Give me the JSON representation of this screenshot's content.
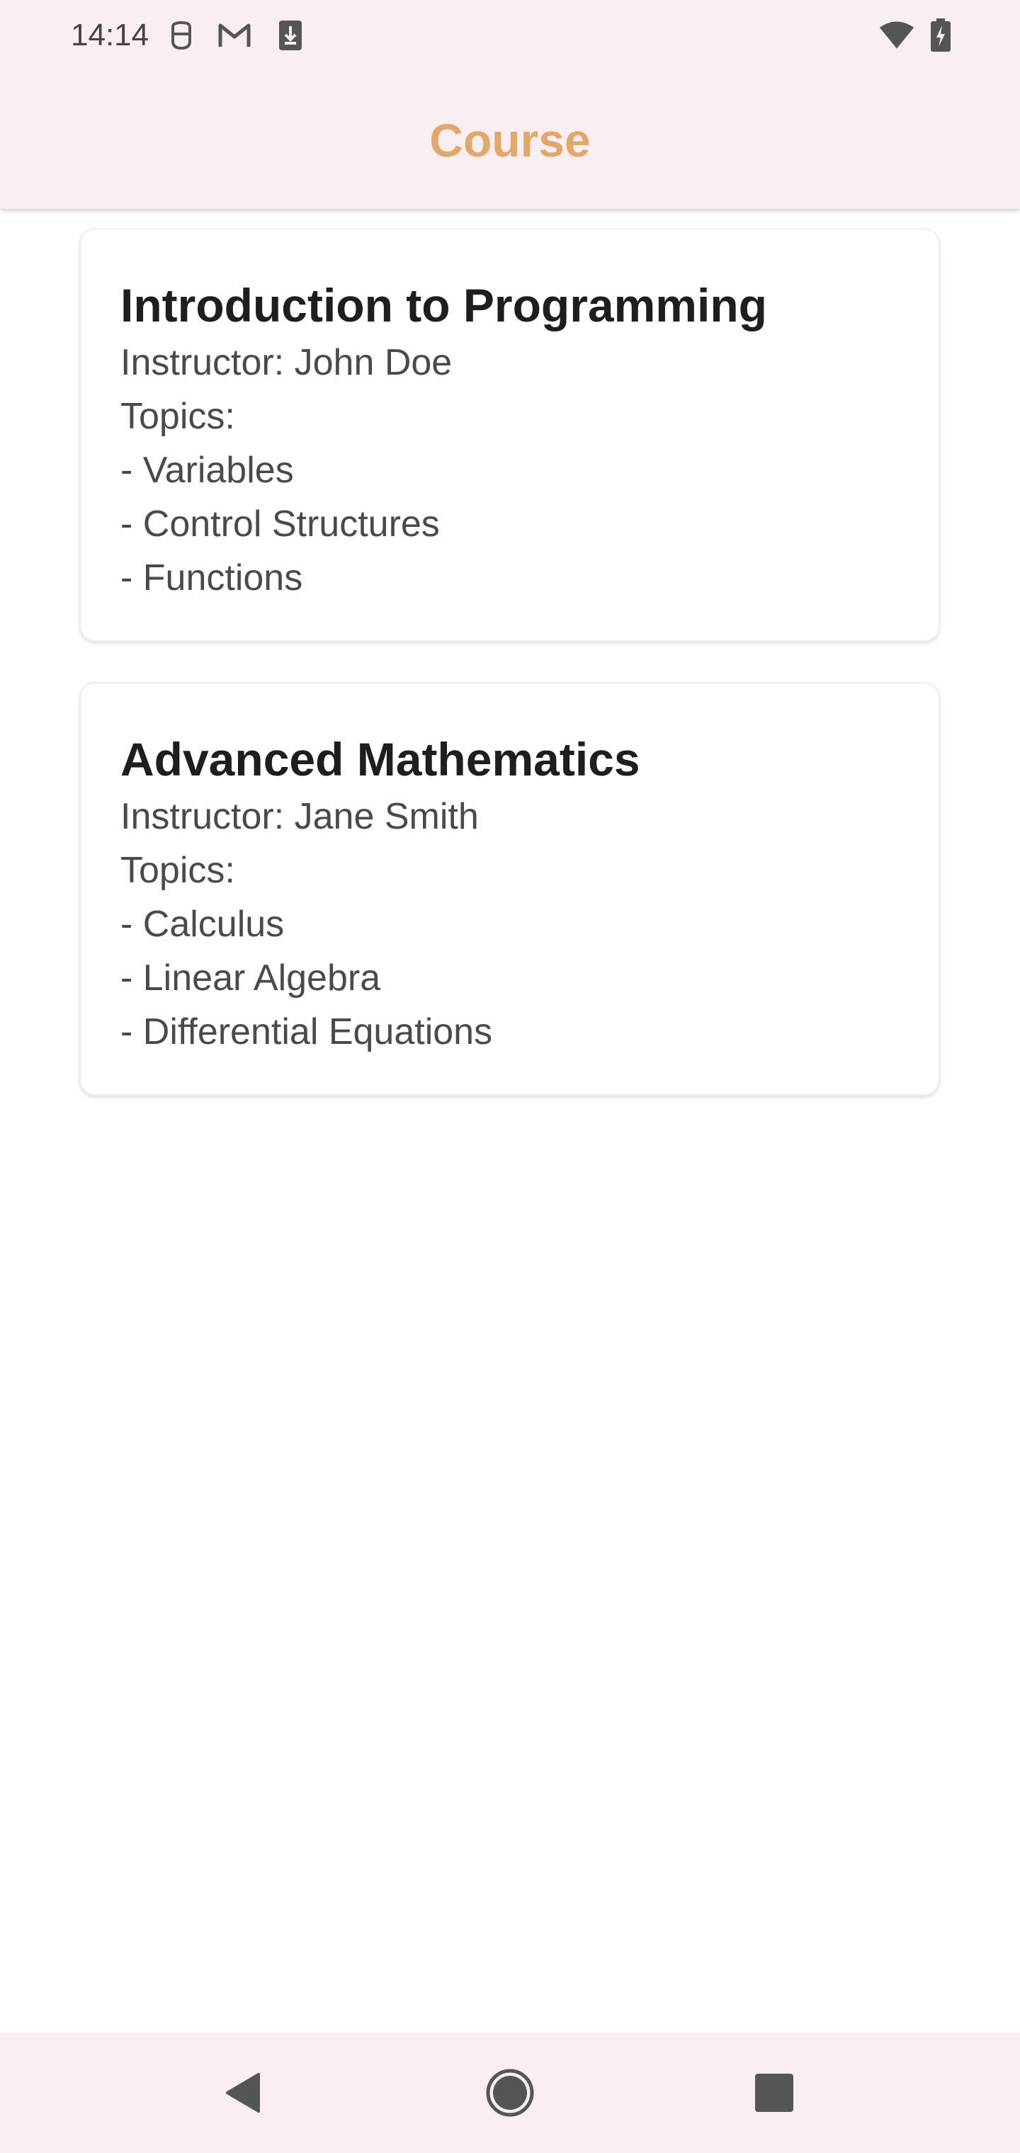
{
  "status_bar": {
    "time": "14:14",
    "icons": [
      "face-notification-icon",
      "gmail-icon",
      "download-icon",
      "wifi-icon",
      "battery-charging-icon"
    ]
  },
  "app_bar": {
    "title": "Course",
    "title_color": "#e0a86b"
  },
  "courses": [
    {
      "title": "Introduction to Programming",
      "instructor": "Instructor: John Doe",
      "topics_label": "Topics:",
      "topics": [
        "- Variables",
        "- Control Structures",
        "- Functions"
      ]
    },
    {
      "title": "Advanced Mathematics",
      "instructor": "Instructor: Jane Smith",
      "topics_label": "Topics:",
      "topics": [
        "- Calculus",
        "- Linear Algebra",
        "- Differential Equations"
      ]
    }
  ],
  "nav_bar": {
    "buttons": [
      "back-icon",
      "home-icon",
      "recents-icon"
    ]
  },
  "colors": {
    "bars_background": "#f9eef1",
    "accent": "#e0a86b"
  }
}
